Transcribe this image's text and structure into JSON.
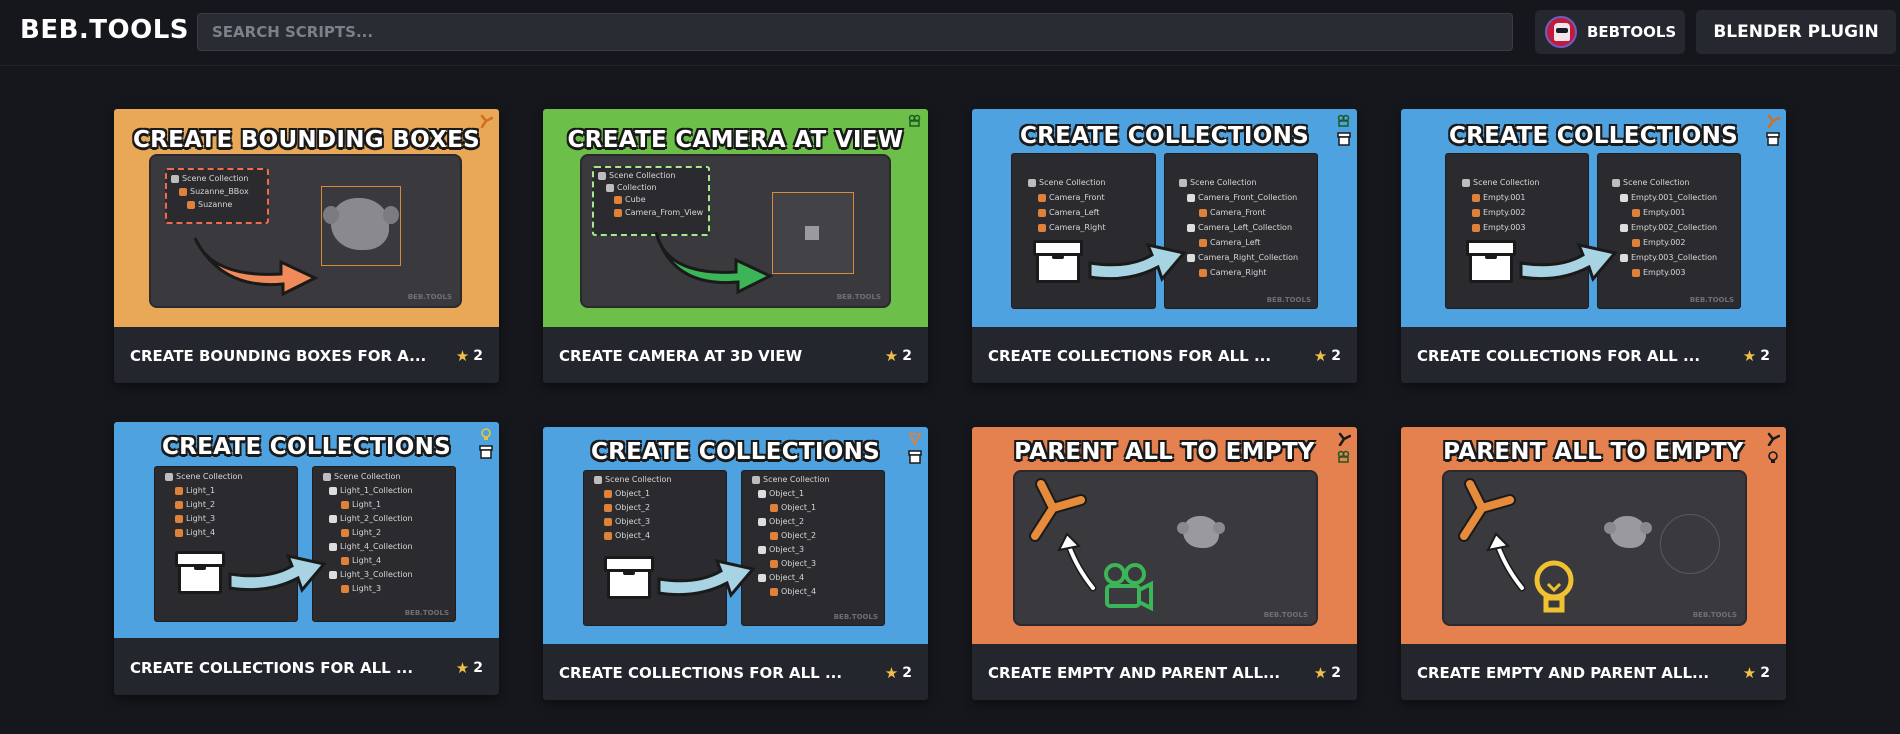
{
  "header": {
    "logo": "BEB.TOOLS",
    "search_placeholder": "SEARCH SCRIPTS...",
    "user_name": "BEBTOOLS",
    "plugin_label": "BLENDER PLUGIN"
  },
  "colors": {
    "orange_thumb": "#e8a857",
    "green_thumb": "#6cc049",
    "blue_thumb": "#4fa2e0",
    "red_orange_thumb": "#e4814f",
    "card_bg": "#24262d",
    "star": "#f2c046"
  },
  "watermark": "BEB.TOOLS",
  "cards": [
    {
      "thumb_title": "CREATE BOUNDING BOXES",
      "title": "CREATE BOUNDING BOXES FOR A...",
      "rating": "2",
      "icons": [
        "empty-axis-icon"
      ],
      "outliner": [
        "Scene Collection",
        "Suzanne_BBox",
        "Suzanne"
      ]
    },
    {
      "thumb_title": "CREATE CAMERA AT VIEW",
      "title": "CREATE CAMERA AT 3D VIEW",
      "rating": "2",
      "icons": [
        "camera-icon"
      ],
      "outliner": [
        "Scene Collection",
        "Collection",
        "Cube",
        "Camera_From_View"
      ]
    },
    {
      "thumb_title": "CREATE COLLECTIONS",
      "title": "CREATE COLLECTIONS FOR ALL ...",
      "rating": "2",
      "icons": [
        "camera-icon",
        "box-icon"
      ],
      "left": [
        "Scene Collection",
        "Camera_Front",
        "Camera_Left",
        "Camera_Right"
      ],
      "right": [
        "Scene Collection",
        "Camera_Front_Collection",
        "Camera_Front",
        "Camera_Left_Collection",
        "Camera_Left",
        "Camera_Right_Collection",
        "Camera_Right"
      ]
    },
    {
      "thumb_title": "CREATE COLLECTIONS",
      "title": "CREATE COLLECTIONS FOR ALL ...",
      "rating": "2",
      "icons": [
        "empty-axis-icon",
        "box-icon"
      ],
      "left": [
        "Scene Collection",
        "Empty.001",
        "Empty.002",
        "Empty.003"
      ],
      "right": [
        "Scene Collection",
        "Empty.001_Collection",
        "Empty.001",
        "Empty.002_Collection",
        "Empty.002",
        "Empty.003_Collection",
        "Empty.003"
      ]
    },
    {
      "thumb_title": "CREATE COLLECTIONS",
      "title": "CREATE COLLECTIONS FOR ALL ...",
      "rating": "2",
      "icons": [
        "light-icon",
        "box-icon"
      ],
      "left": [
        "Scene Collection",
        "Light_1",
        "Light_2",
        "Light_3",
        "Light_4"
      ],
      "right": [
        "Scene Collection",
        "Light_1_Collection",
        "Light_1",
        "Light_2_Collection",
        "Light_2",
        "Light_4_Collection",
        "Light_4",
        "Light_3_Collection",
        "Light_3"
      ]
    },
    {
      "thumb_title": "CREATE COLLECTIONS",
      "title": "CREATE COLLECTIONS FOR ALL ...",
      "rating": "2",
      "icons": [
        "mesh-icon",
        "box-icon"
      ],
      "left": [
        "Scene Collection",
        "Object_1",
        "Object_2",
        "Object_3",
        "Object_4"
      ],
      "right": [
        "Scene Collection",
        "Object_1",
        "Object_1",
        "Object_2",
        "Object_2",
        "Object_3",
        "Object_3",
        "Object_4",
        "Object_4"
      ]
    },
    {
      "thumb_title": "PARENT ALL TO EMPTY",
      "title": "CREATE EMPTY AND PARENT ALL...",
      "rating": "2",
      "icons": [
        "empty-axis-icon",
        "camera-icon"
      ]
    },
    {
      "thumb_title": "PARENT ALL TO EMPTY",
      "title": "CREATE EMPTY AND PARENT ALL...",
      "rating": "2",
      "icons": [
        "empty-axis-icon",
        "light-icon"
      ]
    }
  ]
}
